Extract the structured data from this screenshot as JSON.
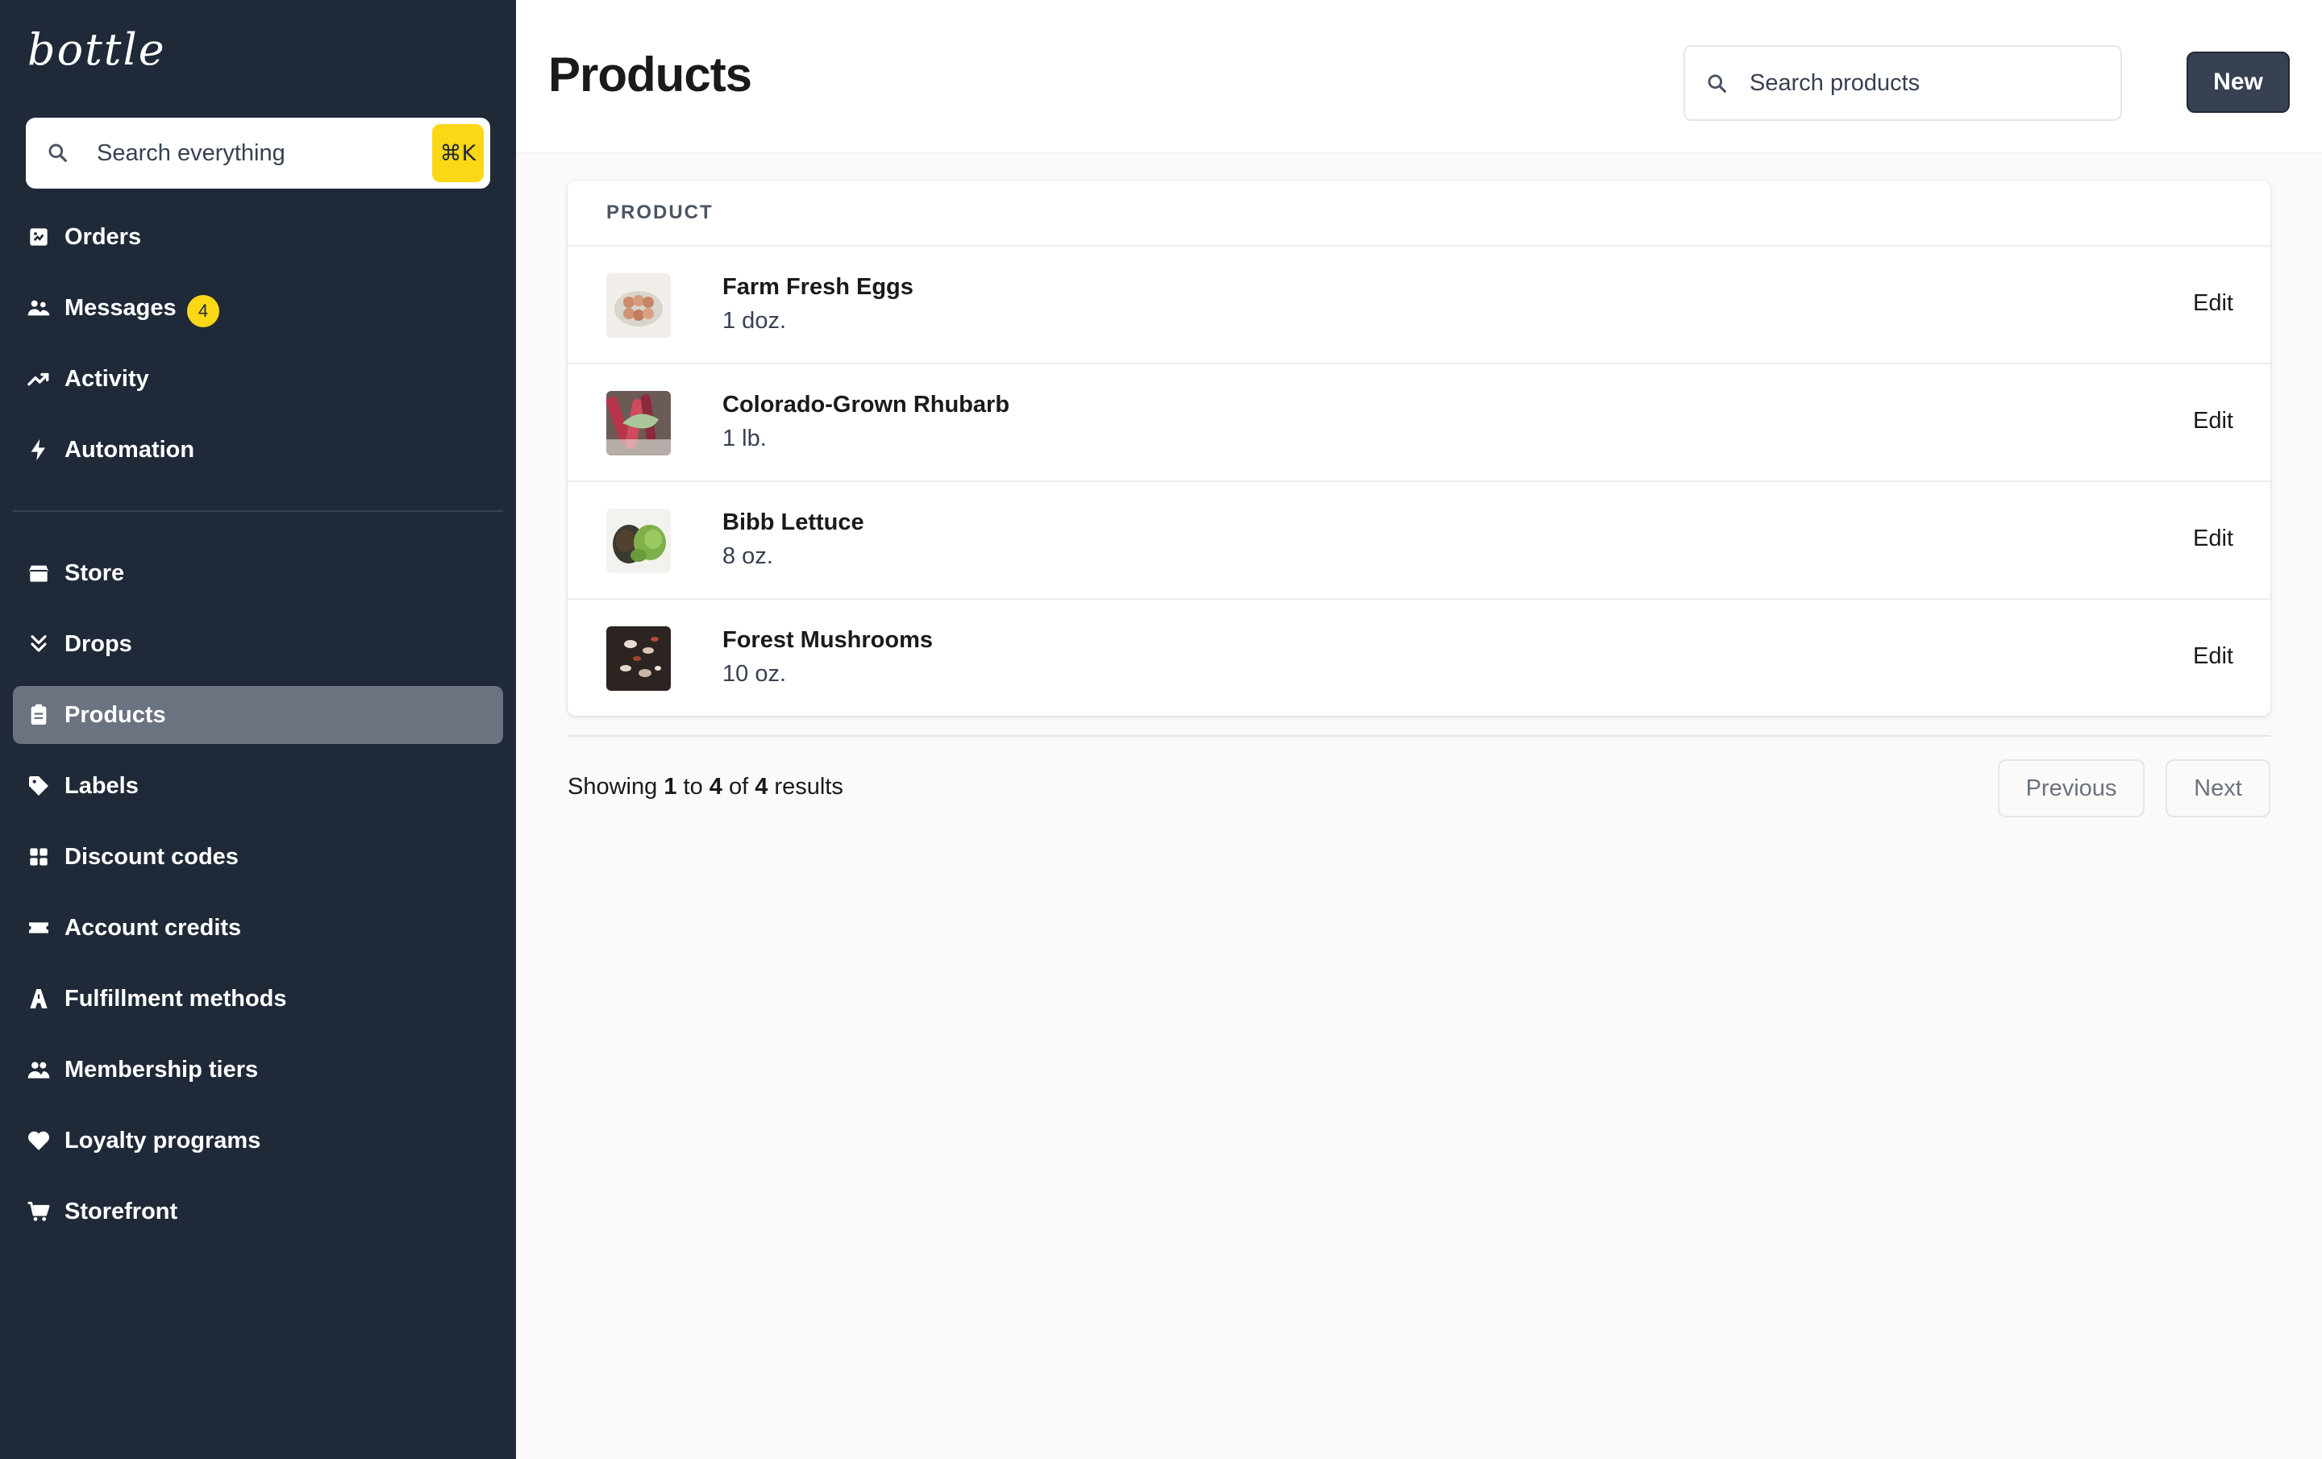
{
  "app": {
    "logo": "bottle"
  },
  "global_search": {
    "placeholder": "Search everything",
    "shortcut": "⌘K"
  },
  "sidebar": {
    "primary": [
      {
        "label": "Orders",
        "icon": "orders-icon"
      },
      {
        "label": "Messages",
        "icon": "people-icon",
        "badge": "4"
      },
      {
        "label": "Activity",
        "icon": "trending-up-icon"
      },
      {
        "label": "Automation",
        "icon": "lightning-icon"
      }
    ],
    "secondary": [
      {
        "label": "Store",
        "icon": "store-icon"
      },
      {
        "label": "Drops",
        "icon": "double-chevron-down-icon"
      },
      {
        "label": "Products",
        "icon": "clipboard-icon",
        "active": true
      },
      {
        "label": "Labels",
        "icon": "tag-icon"
      },
      {
        "label": "Discount codes",
        "icon": "grid-icon"
      },
      {
        "label": "Account credits",
        "icon": "ticket-icon"
      },
      {
        "label": "Fulfillment methods",
        "icon": "road-icon"
      },
      {
        "label": "Membership tiers",
        "icon": "users-icon"
      },
      {
        "label": "Loyalty programs",
        "icon": "heart-icon"
      },
      {
        "label": "Storefront",
        "icon": "cart-icon"
      }
    ]
  },
  "header": {
    "title": "Products",
    "search_placeholder": "Search products",
    "new_label": "New"
  },
  "table": {
    "column_header": "PRODUCT",
    "rows": [
      {
        "name": "Farm Fresh Eggs",
        "size": "1 doz.",
        "action": "Edit"
      },
      {
        "name": "Colorado-Grown Rhubarb",
        "size": "1 lb.",
        "action": "Edit"
      },
      {
        "name": "Bibb Lettuce",
        "size": "8 oz.",
        "action": "Edit"
      },
      {
        "name": "Forest Mushrooms",
        "size": "10 oz.",
        "action": "Edit"
      }
    ]
  },
  "pagination": {
    "prefix": "Showing",
    "from": "1",
    "to_word": "to",
    "to": "4",
    "of_word": "of",
    "total": "4",
    "suffix": "results",
    "previous_label": "Previous",
    "next_label": "Next"
  },
  "colors": {
    "sidebar_bg": "#1f2937",
    "active_item_bg": "#6b7280",
    "accent_yellow": "#fbd716",
    "primary_button": "#374151",
    "page_bg": "#fbfaf8"
  }
}
